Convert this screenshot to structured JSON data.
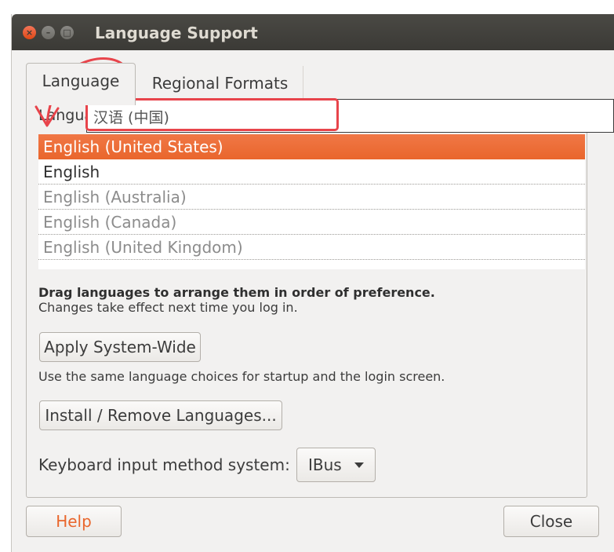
{
  "window": {
    "title": "Language Support",
    "close_glyph": "×",
    "min_glyph": "–",
    "max_glyph": "□"
  },
  "tabs": [
    {
      "label": "Language",
      "active": true
    },
    {
      "label": "Regional Formats",
      "active": false
    }
  ],
  "language_section": {
    "label": "Language for menus and windows:",
    "drag_item": "汉语 (中国)",
    "items": [
      {
        "label": "English (United States)",
        "state": "selected"
      },
      {
        "label": "English",
        "state": "active"
      },
      {
        "label": "English (Australia)",
        "state": "inactive"
      },
      {
        "label": "English (Canada)",
        "state": "inactive"
      },
      {
        "label": "English (United Kingdom)",
        "state": "inactive"
      }
    ]
  },
  "hints": {
    "drag_bold": "Drag languages to arrange them in order of preference.",
    "drag_note": "Changes take effect next time you log in.",
    "same_choices": "Use the same language choices for startup and the login screen."
  },
  "buttons": {
    "apply": "Apply System-Wide",
    "install": "Install / Remove Languages...",
    "help": "Help",
    "close": "Close"
  },
  "keyboard": {
    "label": "Keyboard input method system:",
    "value": "IBus"
  },
  "colors": {
    "selection": "#e9662c",
    "annotation": "#e8444b",
    "titlebar": "#3b3a36"
  }
}
